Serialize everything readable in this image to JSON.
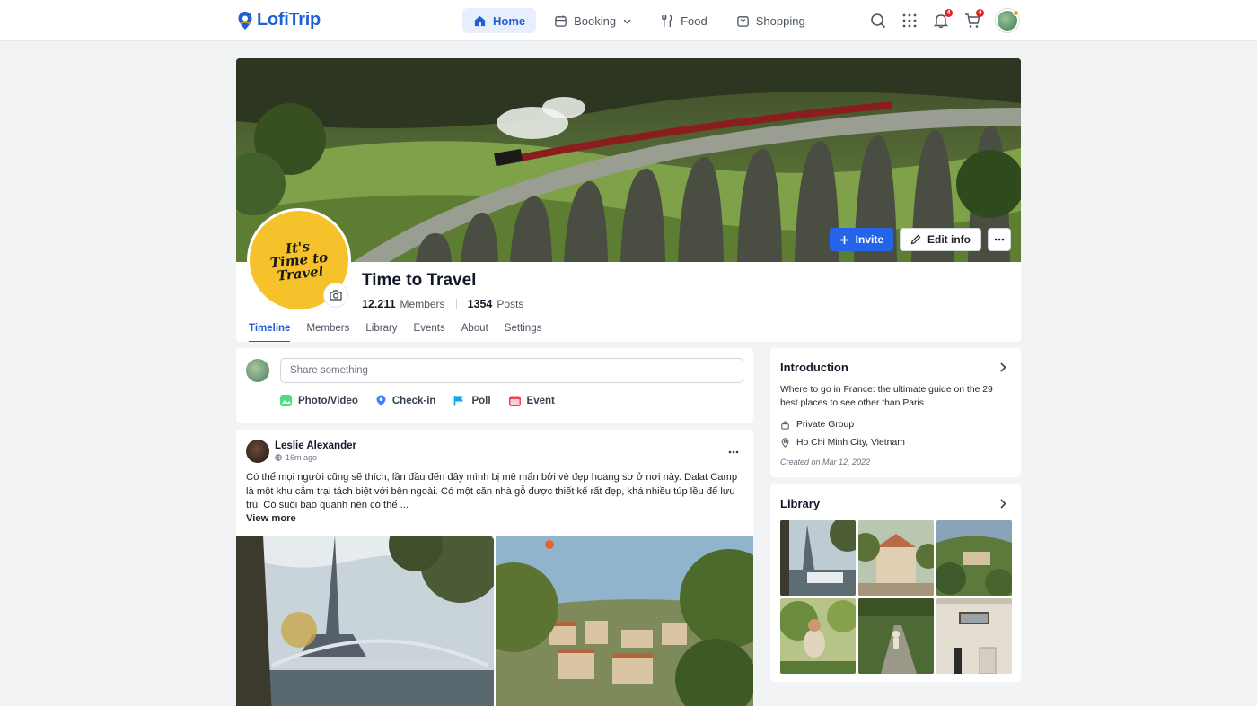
{
  "app": {
    "name": "LofiTrip"
  },
  "nav": {
    "items": [
      {
        "label": "Home",
        "icon": "home-icon",
        "active": true
      },
      {
        "label": "Booking",
        "icon": "calendar-icon",
        "dropdown": true
      },
      {
        "label": "Food",
        "icon": "utensils-icon"
      },
      {
        "label": "Shopping",
        "icon": "shopping-bag-icon"
      }
    ]
  },
  "topbar": {
    "notifications_count": "4",
    "cart_count": "4"
  },
  "group": {
    "name": "Time to Travel",
    "avatar_text": "It's Time to Travel",
    "members_count": "12.211",
    "members_label": "Members",
    "posts_count": "1354",
    "posts_label": "Posts",
    "invite_label": "Invite",
    "edit_label": "Edit info"
  },
  "tabs": [
    "Timeline",
    "Members",
    "Library",
    "Events",
    "About",
    "Settings"
  ],
  "composer": {
    "placeholder": "Share something",
    "actions": [
      {
        "label": "Photo/Video",
        "color": "#4ade80"
      },
      {
        "label": "Check-in",
        "color": "#3b82f6"
      },
      {
        "label": "Poll",
        "color": "#0ea5e9"
      },
      {
        "label": "Event",
        "color": "#f43f5e"
      }
    ]
  },
  "post": {
    "author": "Leslie Alexander",
    "time": "16m ago",
    "body": "Có thể mọi người cũng sẽ thích, lần đầu đến đây mình bị mê mẩn bởi vẻ đẹp hoang sơ ở nơi này. Dalat Camp là một khu cắm trại tách biệt với bên ngoài. Có một căn nhà gỗ được thiết kế rất đẹp, khá nhiều túp lều để lưu trú. Có suối bao quanh nên có thể ...",
    "view_more": "View more"
  },
  "intro": {
    "title": "Introduction",
    "description": "Where to go in France: the ultimate guide on the 29 best places to see other than Paris",
    "privacy": "Private Group",
    "location": "Ho Chi Minh City, Vietnam",
    "created": "Created on Mar 12, 2022"
  },
  "library": {
    "title": "Library"
  },
  "colors": {
    "accent": "#2563eb",
    "brand": "#1f5fd6",
    "badge": "#e02424"
  }
}
